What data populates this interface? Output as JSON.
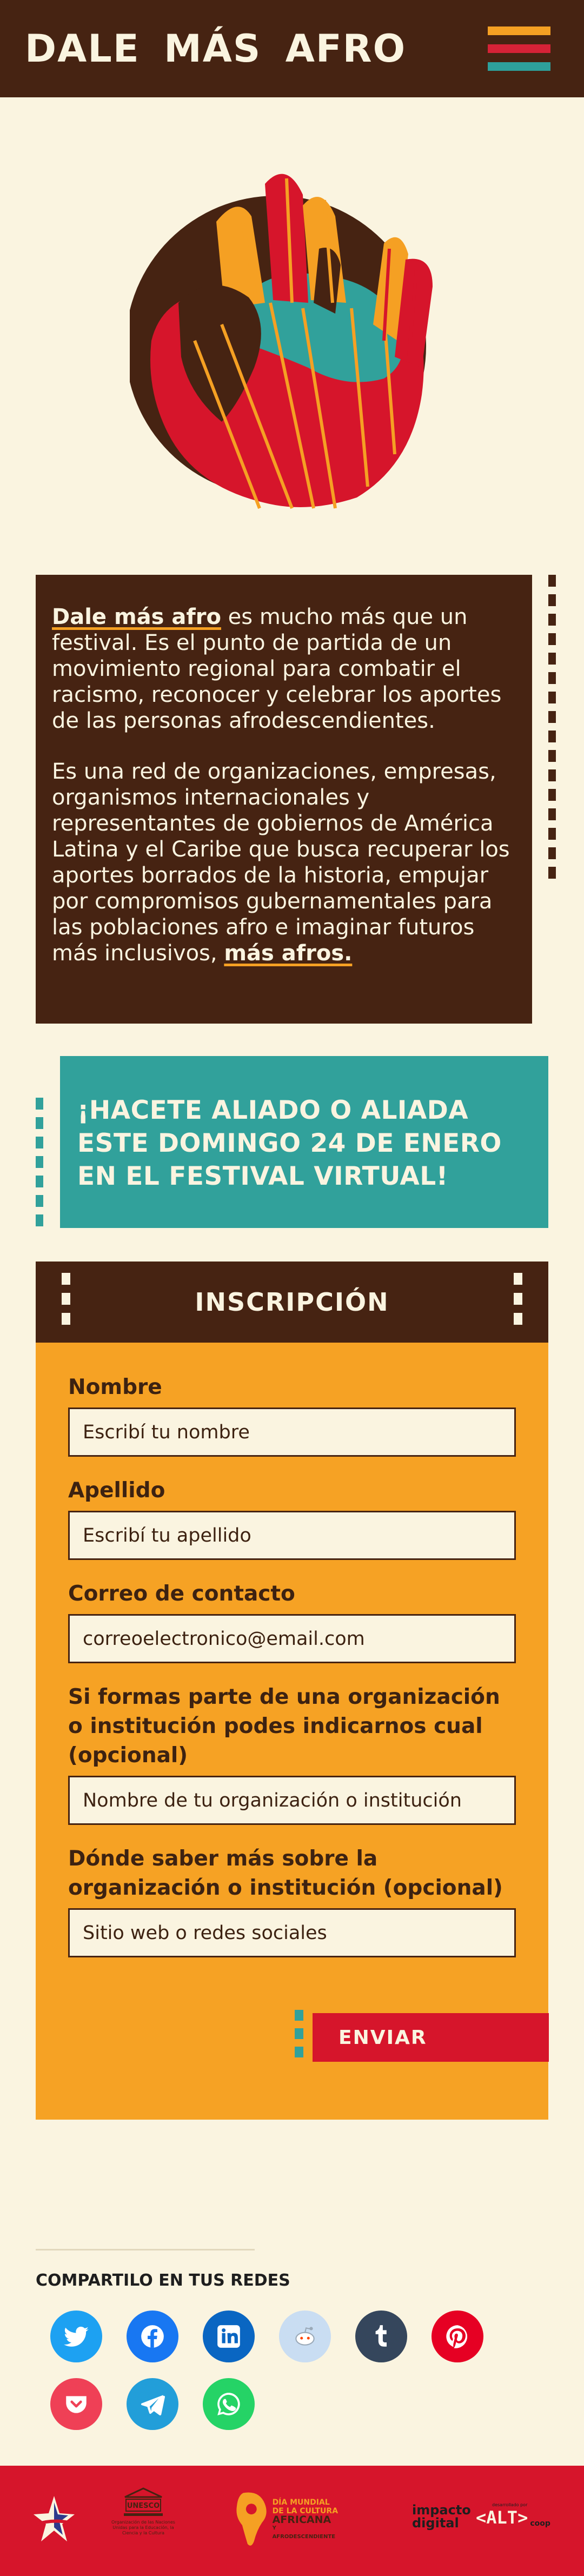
{
  "header": {
    "brand": "DALE MÁS AFRO",
    "menu_icon": "hamburger-menu-icon",
    "menu_colors": [
      "#F5A023",
      "#D62237",
      "#2EA09B"
    ]
  },
  "hero": {
    "illustration": "hand-illustration"
  },
  "intro": {
    "p1_strong": "Dale más afro",
    "p1_rest": " es mucho más que un festival. Es el punto de partida de un movimiento regional para combatir el racismo, reconocer y celebrar los aportes de las personas afrodescendientes.",
    "p2_text": "Es una red de organizaciones, empresas, organismos internacionales y representantes de gobiernos de América Latina y el Caribe que busca recuperar los aportes borrados de la historia, empujar por compromisos gubernamentales para las poblaciones afro e imaginar futuros más inclusivos, ",
    "p2_strong": "más afros."
  },
  "cta": {
    "text": "¡HACETE ALIADO O ALIADA ESTE DOMINGO 24 DE ENERO EN EL FESTIVAL VIRTUAL!"
  },
  "form": {
    "title": "INSCRIPCIÓN",
    "fields": [
      {
        "label": "Nombre",
        "placeholder": "Escribí tu nombre"
      },
      {
        "label": "Apellido",
        "placeholder": "Escribí tu apellido"
      },
      {
        "label": "Correo de contacto",
        "placeholder": "correoelectronico@email.com"
      },
      {
        "label": "Si formas parte de una organización o institución podes indicarnos cual (opcional)",
        "placeholder": "Nombre de tu organización o institución"
      },
      {
        "label": "Dónde saber más sobre la organización o institución (opcional)",
        "placeholder": "Sitio web o redes sociales"
      }
    ],
    "submit_label": "ENVIAR"
  },
  "share": {
    "title": "COMPARTILO EN TUS REDES",
    "buttons": [
      {
        "icon": "twitter-icon",
        "color": "#1DA1F2"
      },
      {
        "icon": "facebook-icon",
        "color": "#1877F2"
      },
      {
        "icon": "linkedin-icon",
        "color": "#0A66C2"
      },
      {
        "icon": "reddit-icon",
        "color": "#C9DDF2"
      },
      {
        "icon": "tumblr-icon",
        "color": "#35465C"
      },
      {
        "icon": "pinterest-icon",
        "color": "#E60023"
      },
      {
        "icon": "pocket-icon",
        "color": "#EF4056"
      },
      {
        "icon": "telegram-icon",
        "color": "#229ED9"
      },
      {
        "icon": "whatsapp-icon",
        "color": "#25D366"
      }
    ]
  },
  "footer": {
    "logos": [
      {
        "icon": "star-logo-icon"
      },
      {
        "icon": "unesco-logo-icon",
        "text": "Organización de las Naciones Unidas para la Educación, la Ciencia y la Cultura"
      },
      {
        "icon": "africa-day-logo-icon",
        "line1": "DÍA MUNDIAL",
        "line2": "DE LA CULTURA",
        "line3": "AFRICANA",
        "line4": "Y AFRODESCENDIENTE"
      },
      {
        "icon": "impacto-digital-logo-icon",
        "line1": "impacto",
        "line2": "digital"
      },
      {
        "icon": "alt-coop-logo-icon",
        "small": "desarrollado por",
        "text": "<ALT>",
        "suffix": "coop"
      }
    ]
  }
}
